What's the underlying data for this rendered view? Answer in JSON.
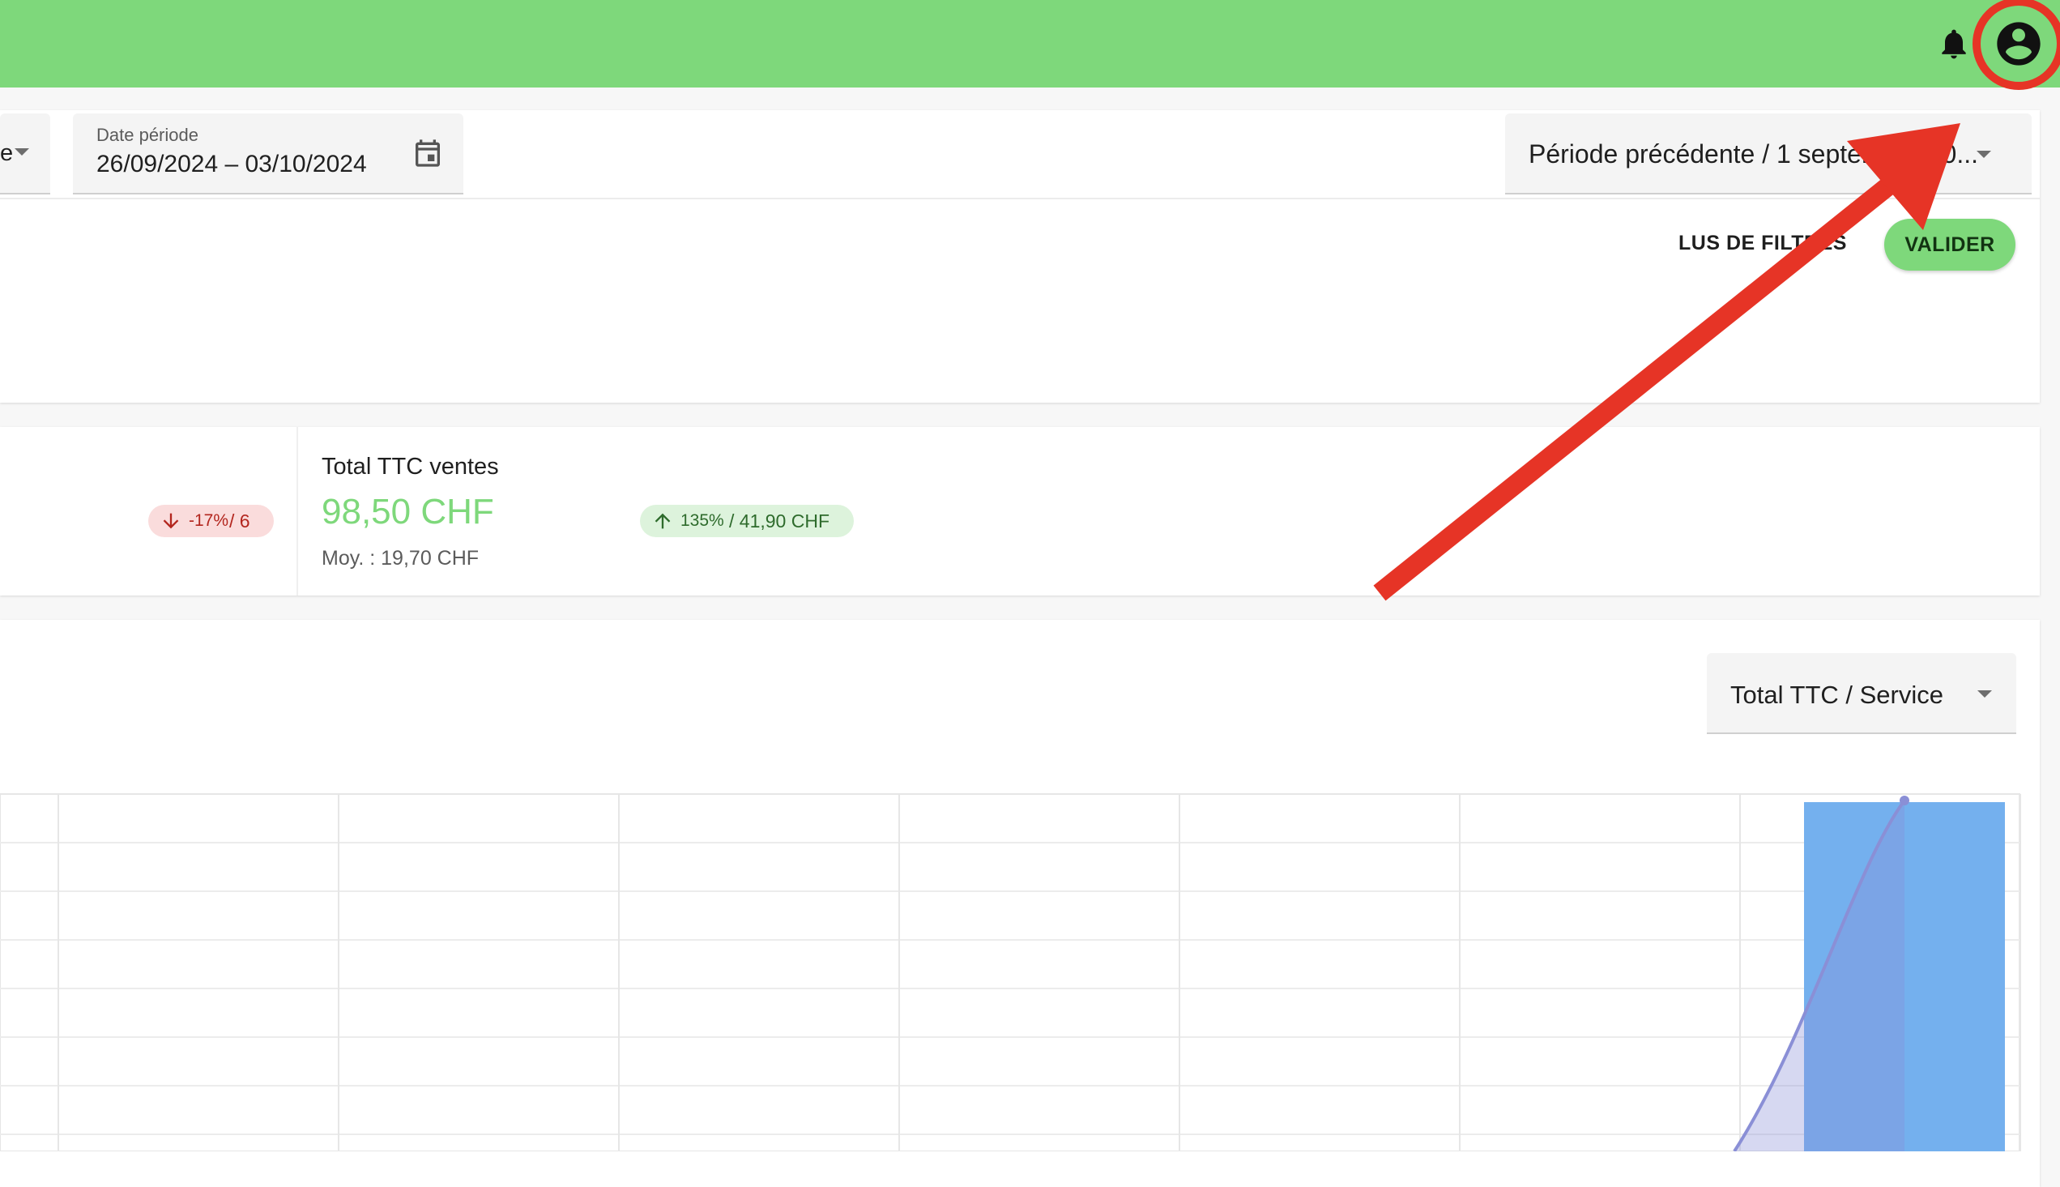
{
  "header": {
    "bell_icon": "bell-icon",
    "account_icon": "account-circle-icon"
  },
  "filters": {
    "left_select_fragment": "e",
    "date_label": "Date période",
    "date_value": "26/09/2024 – 03/10/2024",
    "calendar_icon": "calendar-icon",
    "compare_value": "Période précédente / 1 septembre 20...",
    "more_filters_label": "LUS DE FILTRES",
    "validate_label": "VALIDER"
  },
  "kpi": {
    "left_badge": {
      "pct": "-17%",
      "rest": " / 6",
      "direction": "down"
    },
    "title": "Total TTC ventes",
    "value": "98,50 CHF",
    "avg": "Moy. : 19,70 CHF",
    "badge": {
      "pct": "135%",
      "rest": " / 41,90 CHF",
      "direction": "up"
    }
  },
  "chart": {
    "metric_select_value": "Total TTC / Service"
  },
  "chart_data": {
    "type": "bar",
    "categories": [
      "",
      "",
      "",
      "",
      "",
      "",
      ""
    ],
    "series": [
      {
        "type": "bar",
        "values": [
          0,
          0,
          0,
          0,
          0,
          0,
          1
        ]
      },
      {
        "type": "area",
        "values": [
          0,
          0,
          0,
          0,
          0,
          0,
          1
        ]
      }
    ],
    "grid": true,
    "colors": {
      "bar": "#74b0ee",
      "line": "#8a8fd6"
    }
  },
  "colors": {
    "header": "#7ed87b",
    "accent": "#7ed87b",
    "annotation": "#e63426"
  }
}
